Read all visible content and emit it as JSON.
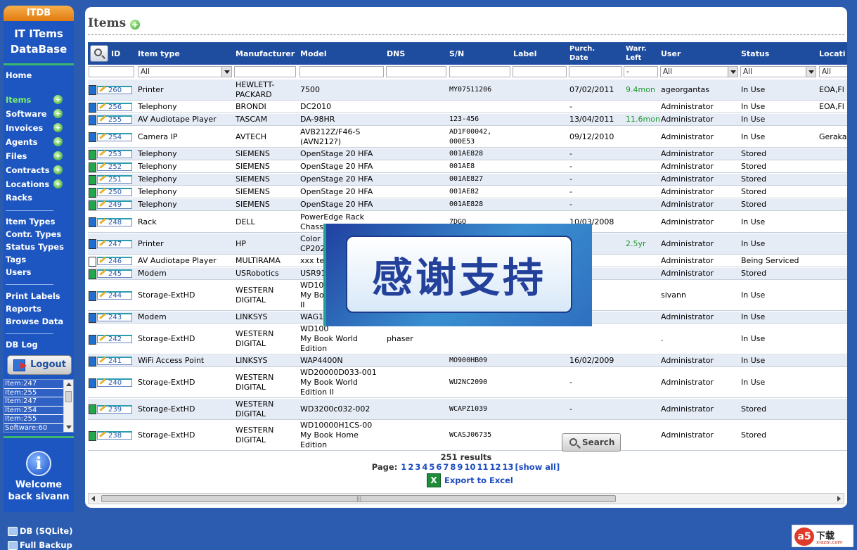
{
  "app": {
    "logo_tab": "ITDB",
    "logo_line1": "IT ITems",
    "logo_line2": "DataBase"
  },
  "nav": {
    "home": "Home",
    "items": "Items",
    "software": "Software",
    "invoices": "Invoices",
    "agents": "Agents",
    "files": "Files",
    "contracts": "Contracts",
    "locations": "Locations",
    "racks": "Racks",
    "item_types": "Item Types",
    "contr_types": "Contr. Types",
    "status_types": "Status Types",
    "tags": "Tags",
    "users": "Users",
    "print_labels": "Print Labels",
    "reports": "Reports",
    "browse_data": "Browse Data",
    "db_log": "DB Log",
    "logout": "Logout"
  },
  "history": [
    "Item:247",
    "Item:255",
    "Item:247",
    "Item:254",
    "Item:255",
    "Software:60"
  ],
  "welcome": {
    "line1": "Welcome",
    "line2": "back sivann"
  },
  "db": {
    "db_label": "DB (SQLite)",
    "backup_label": "Full Backup"
  },
  "page": {
    "title": "Items"
  },
  "columns": {
    "id": "ID",
    "item_type": "Item type",
    "manufacturer": "Manufacturer",
    "model": "Model",
    "dns": "DNS",
    "sn": "S/N",
    "label": "Label",
    "purch_date_1": "Purch.",
    "purch_date_2": "Date",
    "warr_left_1": "Warr.",
    "warr_left_2": "Left",
    "user": "User",
    "status": "Status",
    "location": "Locati"
  },
  "filters": {
    "item_type": "All",
    "warr": "-",
    "user": "All",
    "status": "All",
    "location": "All"
  },
  "colors": {
    "blue": "#1f6fd0",
    "green": "#22a84a",
    "white": "#ffffff",
    "warr_text": "#1c9a30"
  },
  "rows": [
    {
      "swatch": "blue",
      "id": "260",
      "type": "Printer",
      "mfr": [
        "HEWLETT-",
        "PACKARD"
      ],
      "model": [
        "7500"
      ],
      "dns": "",
      "sn": [
        "MY07511206"
      ],
      "purch": "07/02/2011",
      "warr": "9.4mon",
      "user": "ageorgantas",
      "status": "In Use",
      "loc": "EOA,Fl"
    },
    {
      "swatch": "blue",
      "id": "256",
      "type": "Telephony",
      "mfr": [
        "BRONDI"
      ],
      "model": [
        "DC2010"
      ],
      "dns": "",
      "sn": [
        ""
      ],
      "purch": "-",
      "warr": "",
      "user": "Administrator",
      "status": "In Use",
      "loc": "EOA,Fl"
    },
    {
      "swatch": "blue",
      "id": "255",
      "type": "AV Audiotape Player",
      "mfr": [
        "TASCAM"
      ],
      "model": [
        "DA-98HR"
      ],
      "dns": "",
      "sn": [
        "123-456"
      ],
      "purch": "13/04/2011",
      "warr": "11.6mon",
      "user": "Administrator",
      "status": "In Use",
      "loc": ""
    },
    {
      "swatch": "blue",
      "id": "254",
      "type": "Camera IP",
      "mfr": [
        "AVTECH"
      ],
      "model": [
        "AVB212Z/F46-S",
        "(AVN212?)"
      ],
      "dns": "",
      "sn": [
        "AD1F00042,",
        "000E53"
      ],
      "purch": "09/12/2010",
      "warr": "",
      "user": "Administrator",
      "status": "In Use",
      "loc": "Geraka"
    },
    {
      "swatch": "green",
      "id": "253",
      "type": "Telephony",
      "mfr": [
        "SIEMENS"
      ],
      "model": [
        "OpenStage 20 HFA"
      ],
      "dns": "",
      "sn": [
        "001AE828"
      ],
      "purch": "-",
      "warr": "",
      "user": "Administrator",
      "status": "Stored",
      "loc": ""
    },
    {
      "swatch": "green",
      "id": "252",
      "type": "Telephony",
      "mfr": [
        "SIEMENS"
      ],
      "model": [
        "OpenStage 20 HFA"
      ],
      "dns": "",
      "sn": [
        "001AE8"
      ],
      "purch": "-",
      "warr": "",
      "user": "Administrator",
      "status": "Stored",
      "loc": ""
    },
    {
      "swatch": "green",
      "id": "251",
      "type": "Telephony",
      "mfr": [
        "SIEMENS"
      ],
      "model": [
        "OpenStage 20 HFA"
      ],
      "dns": "",
      "sn": [
        "001AE827"
      ],
      "purch": "-",
      "warr": "",
      "user": "Administrator",
      "status": "Stored",
      "loc": ""
    },
    {
      "swatch": "green",
      "id": "250",
      "type": "Telephony",
      "mfr": [
        "SIEMENS"
      ],
      "model": [
        "OpenStage 20 HFA"
      ],
      "dns": "",
      "sn": [
        "001AE82"
      ],
      "purch": "-",
      "warr": "",
      "user": "Administrator",
      "status": "Stored",
      "loc": ""
    },
    {
      "swatch": "green",
      "id": "249",
      "type": "Telephony",
      "mfr": [
        "SIEMENS"
      ],
      "model": [
        "OpenStage 20 HFA"
      ],
      "dns": "",
      "sn": [
        "001AE828"
      ],
      "purch": "-",
      "warr": "",
      "user": "Administrator",
      "status": "Stored",
      "loc": ""
    },
    {
      "swatch": "blue",
      "id": "248",
      "type": "Rack",
      "mfr": [
        "DELL"
      ],
      "model": [
        "PowerEdge Rack",
        "Chassis 4210"
      ],
      "dns": "",
      "sn": [
        "7DGQ"
      ],
      "purch": "10/03/2008",
      "warr": "",
      "user": "Administrator",
      "status": "In Use",
      "loc": ""
    },
    {
      "swatch": "blue",
      "id": "247",
      "type": "Printer",
      "mfr": [
        "HP"
      ],
      "model": [
        "Color L",
        "CP202"
      ],
      "dns": "",
      "sn": [
        ""
      ],
      "purch": "/2010",
      "warr": "2.5yr",
      "user": "Administrator",
      "status": "In Use",
      "loc": ""
    },
    {
      "swatch": "white",
      "id": "246",
      "type": "AV Audiotape Player",
      "mfr": [
        "MULTIRAMA"
      ],
      "model": [
        "xxx te"
      ],
      "dns": "",
      "sn": [
        ""
      ],
      "purch": "",
      "warr": "",
      "user": "Administrator",
      "status": "Being Serviced",
      "loc": ""
    },
    {
      "swatch": "green",
      "id": "245",
      "type": "Modem",
      "mfr": [
        "USRobotics"
      ],
      "model": [
        "USR91"
      ],
      "dns": "",
      "sn": [
        ""
      ],
      "purch": "",
      "warr": "",
      "user": "Administrator",
      "status": "Stored",
      "loc": ""
    },
    {
      "swatch": "blue",
      "id": "244",
      "type": "Storage-ExtHD",
      "mfr": [
        "WESTERN",
        "DIGITAL"
      ],
      "model": [
        "WD100",
        "My Boo",
        "II"
      ],
      "dns": "",
      "sn": [
        ""
      ],
      "purch": "",
      "warr": "",
      "user": "sivann",
      "status": "In Use",
      "loc": ""
    },
    {
      "swatch": "blue",
      "id": "243",
      "type": "Modem",
      "mfr": [
        "LINKSYS"
      ],
      "model": [
        "WAG1"
      ],
      "dns": "",
      "sn": [
        ""
      ],
      "purch": "/2010",
      "warr": "",
      "user": "Administrator",
      "status": "In Use",
      "loc": ""
    },
    {
      "swatch": "blue",
      "id": "242",
      "type": "Storage-ExtHD",
      "mfr": [
        "WESTERN",
        "DIGITAL"
      ],
      "model": [
        "WD100",
        "My Book World",
        "Edition"
      ],
      "dns": "phaser",
      "sn": [
        ""
      ],
      "purch": "",
      "warr": "",
      "user": ".",
      "status": "In Use",
      "loc": ""
    },
    {
      "swatch": "blue",
      "id": "241",
      "type": "WiFi Access Point",
      "mfr": [
        "LINKSYS"
      ],
      "model": [
        "WAP4400N"
      ],
      "dns": "",
      "sn": [
        "MO900HB09"
      ],
      "purch": "16/02/2009",
      "warr": "",
      "user": "Administrator",
      "status": "In Use",
      "loc": ""
    },
    {
      "swatch": "blue",
      "id": "240",
      "type": "Storage-ExtHD",
      "mfr": [
        "WESTERN",
        "DIGITAL"
      ],
      "model": [
        "WD20000D033-001",
        "My Book World",
        "Edition II"
      ],
      "dns": "",
      "sn": [
        "WU2NC2090"
      ],
      "purch": "-",
      "warr": "",
      "user": "Administrator",
      "status": "In Use",
      "loc": ""
    },
    {
      "swatch": "green",
      "id": "239",
      "type": "Storage-ExtHD",
      "mfr": [
        "WESTERN",
        "DIGITAL"
      ],
      "model": [
        "WD3200c032-002"
      ],
      "dns": "",
      "sn": [
        "WCAPZ1039"
      ],
      "purch": "-",
      "warr": "",
      "user": "Administrator",
      "status": "Stored",
      "loc": ""
    },
    {
      "swatch": "green",
      "id": "238",
      "type": "Storage-ExtHD",
      "mfr": [
        "WESTERN",
        "DIGITAL"
      ],
      "model": [
        "WD10000H1CS-00",
        "My Book Home",
        "Edition"
      ],
      "dns": "",
      "sn": [
        "WCASJ06735"
      ],
      "purch": "-",
      "warr": "",
      "user": "Administrator",
      "status": "Stored",
      "loc": ""
    }
  ],
  "overlay": {
    "text": "感谢支持"
  },
  "footer": {
    "search_label": "Search",
    "results": "251 results",
    "page_label": "Page:",
    "pages": [
      "1",
      "2",
      "3",
      "4",
      "5",
      "6",
      "7",
      "8",
      "9",
      "10",
      "11",
      "12",
      "13"
    ],
    "show_all": "[show all]",
    "export": "Export to Excel",
    "excel_icon": "X"
  },
  "watermark": {
    "logo": "a5",
    "text": "下载",
    "sub": "xiazai.com"
  }
}
